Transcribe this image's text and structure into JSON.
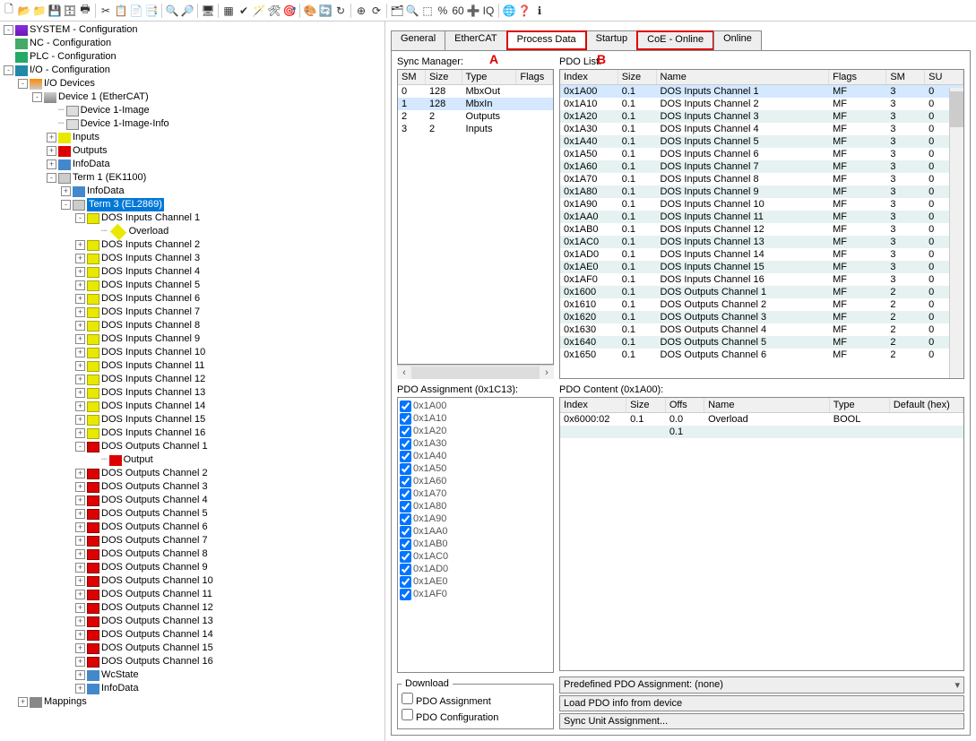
{
  "toolbar_icons": [
    "new-file",
    "open",
    "open-folder",
    "save",
    "save-all",
    "print",
    "|",
    "cut",
    "copy",
    "paste",
    "paste-sp",
    "|",
    "find",
    "find-next",
    "|",
    "device",
    "|",
    "box1",
    "check",
    "wizard",
    "wrench",
    "target",
    "|",
    "palette",
    "sync",
    "refresh",
    "|",
    "target2",
    "free-run",
    "|",
    "tree",
    "zoom",
    "net",
    "percent",
    "sixty",
    "plus",
    "iq",
    "|",
    "globe",
    "help",
    "about"
  ],
  "tree": [
    {
      "exp": "-",
      "ico": "i-sys",
      "label": "SYSTEM - Configuration"
    },
    {
      "exp": " ",
      "ico": "i-nc",
      "label": "NC - Configuration",
      "indent": 0
    },
    {
      "exp": " ",
      "ico": "i-plc",
      "label": "PLC - Configuration",
      "indent": 0
    },
    {
      "exp": "-",
      "ico": "i-io",
      "label": "I/O - Configuration",
      "indent": 0
    },
    {
      "exp": "-",
      "ico": "i-devs",
      "label": "I/O Devices",
      "indent": 1
    },
    {
      "exp": "-",
      "ico": "i-dev",
      "label": "Device 1 (EtherCAT)",
      "indent": 2
    },
    {
      "exp": " ",
      "ico": "i-img",
      "label": "Device 1-Image",
      "indent": 3,
      "dots": true
    },
    {
      "exp": " ",
      "ico": "i-img",
      "label": "Device 1-Image-Info",
      "indent": 3,
      "dots": true
    },
    {
      "exp": "+",
      "ico": "i-in",
      "label": "Inputs",
      "indent": 3
    },
    {
      "exp": "+",
      "ico": "i-out",
      "label": "Outputs",
      "indent": 3
    },
    {
      "exp": "+",
      "ico": "i-info",
      "label": "InfoData",
      "indent": 3
    },
    {
      "exp": "-",
      "ico": "i-term",
      "label": "Term 1 (EK1100)",
      "indent": 3
    },
    {
      "exp": "+",
      "ico": "i-info",
      "label": "InfoData",
      "indent": 4
    },
    {
      "exp": "-",
      "ico": "i-term",
      "label": "Term 3 (EL2869)",
      "indent": 4,
      "sel": true
    },
    {
      "exp": "-",
      "ico": "i-dosin",
      "label": "DOS Inputs Channel 1",
      "indent": 5
    },
    {
      "exp": " ",
      "ico": "i-ov",
      "label": "Overload",
      "indent": 6,
      "dots": true
    },
    {
      "exp": "+",
      "ico": "i-dosin",
      "label": "DOS Inputs Channel 2",
      "indent": 5
    },
    {
      "exp": "+",
      "ico": "i-dosin",
      "label": "DOS Inputs Channel 3",
      "indent": 5
    },
    {
      "exp": "+",
      "ico": "i-dosin",
      "label": "DOS Inputs Channel 4",
      "indent": 5
    },
    {
      "exp": "+",
      "ico": "i-dosin",
      "label": "DOS Inputs Channel 5",
      "indent": 5
    },
    {
      "exp": "+",
      "ico": "i-dosin",
      "label": "DOS Inputs Channel 6",
      "indent": 5
    },
    {
      "exp": "+",
      "ico": "i-dosin",
      "label": "DOS Inputs Channel 7",
      "indent": 5
    },
    {
      "exp": "+",
      "ico": "i-dosin",
      "label": "DOS Inputs Channel 8",
      "indent": 5
    },
    {
      "exp": "+",
      "ico": "i-dosin",
      "label": "DOS Inputs Channel 9",
      "indent": 5
    },
    {
      "exp": "+",
      "ico": "i-dosin",
      "label": "DOS Inputs Channel 10",
      "indent": 5
    },
    {
      "exp": "+",
      "ico": "i-dosin",
      "label": "DOS Inputs Channel 11",
      "indent": 5
    },
    {
      "exp": "+",
      "ico": "i-dosin",
      "label": "DOS Inputs Channel 12",
      "indent": 5
    },
    {
      "exp": "+",
      "ico": "i-dosin",
      "label": "DOS Inputs Channel 13",
      "indent": 5
    },
    {
      "exp": "+",
      "ico": "i-dosin",
      "label": "DOS Inputs Channel 14",
      "indent": 5
    },
    {
      "exp": "+",
      "ico": "i-dosin",
      "label": "DOS Inputs Channel 15",
      "indent": 5
    },
    {
      "exp": "+",
      "ico": "i-dosin",
      "label": "DOS Inputs Channel 16",
      "indent": 5
    },
    {
      "exp": "-",
      "ico": "i-dosout",
      "label": "DOS Outputs Channel 1",
      "indent": 5
    },
    {
      "exp": " ",
      "ico": "i-out",
      "label": "Output",
      "indent": 6,
      "dots": true
    },
    {
      "exp": "+",
      "ico": "i-dosout",
      "label": "DOS Outputs Channel 2",
      "indent": 5
    },
    {
      "exp": "+",
      "ico": "i-dosout",
      "label": "DOS Outputs Channel 3",
      "indent": 5
    },
    {
      "exp": "+",
      "ico": "i-dosout",
      "label": "DOS Outputs Channel 4",
      "indent": 5
    },
    {
      "exp": "+",
      "ico": "i-dosout",
      "label": "DOS Outputs Channel 5",
      "indent": 5
    },
    {
      "exp": "+",
      "ico": "i-dosout",
      "label": "DOS Outputs Channel 6",
      "indent": 5
    },
    {
      "exp": "+",
      "ico": "i-dosout",
      "label": "DOS Outputs Channel 7",
      "indent": 5
    },
    {
      "exp": "+",
      "ico": "i-dosout",
      "label": "DOS Outputs Channel 8",
      "indent": 5
    },
    {
      "exp": "+",
      "ico": "i-dosout",
      "label": "DOS Outputs Channel 9",
      "indent": 5
    },
    {
      "exp": "+",
      "ico": "i-dosout",
      "label": "DOS Outputs Channel 10",
      "indent": 5
    },
    {
      "exp": "+",
      "ico": "i-dosout",
      "label": "DOS Outputs Channel 11",
      "indent": 5
    },
    {
      "exp": "+",
      "ico": "i-dosout",
      "label": "DOS Outputs Channel 12",
      "indent": 5
    },
    {
      "exp": "+",
      "ico": "i-dosout",
      "label": "DOS Outputs Channel 13",
      "indent": 5
    },
    {
      "exp": "+",
      "ico": "i-dosout",
      "label": "DOS Outputs Channel 14",
      "indent": 5
    },
    {
      "exp": "+",
      "ico": "i-dosout",
      "label": "DOS Outputs Channel 15",
      "indent": 5
    },
    {
      "exp": "+",
      "ico": "i-dosout",
      "label": "DOS Outputs Channel 16",
      "indent": 5
    },
    {
      "exp": "+",
      "ico": "i-info",
      "label": "WcState",
      "indent": 5
    },
    {
      "exp": "+",
      "ico": "i-info",
      "label": "InfoData",
      "indent": 5
    },
    {
      "exp": "+",
      "ico": "i-map",
      "label": "Mappings",
      "indent": 1
    }
  ],
  "tabs": [
    "General",
    "EtherCAT",
    "Process Data",
    "Startup",
    "CoE - Online",
    "Online"
  ],
  "active_tab": 2,
  "hl_tabs": [
    2,
    4
  ],
  "annot_a": "A",
  "annot_b": "B",
  "sm": {
    "label": "Sync Manager:",
    "headers": [
      "SM",
      "Size",
      "Type",
      "Flags"
    ],
    "rows": [
      [
        "0",
        "128",
        "MbxOut",
        ""
      ],
      [
        "1",
        "128",
        "MbxIn",
        ""
      ],
      [
        "2",
        "2",
        "Outputs",
        ""
      ],
      [
        "3",
        "2",
        "Inputs",
        ""
      ]
    ],
    "sel": 1
  },
  "pdol": {
    "label": "PDO List:",
    "headers": [
      "Index",
      "Size",
      "Name",
      "Flags",
      "SM",
      "SU"
    ],
    "rows": [
      [
        "0x1A00",
        "0.1",
        "DOS Inputs Channel 1",
        "MF",
        "3",
        "0"
      ],
      [
        "0x1A10",
        "0.1",
        "DOS Inputs Channel 2",
        "MF",
        "3",
        "0"
      ],
      [
        "0x1A20",
        "0.1",
        "DOS Inputs Channel 3",
        "MF",
        "3",
        "0"
      ],
      [
        "0x1A30",
        "0.1",
        "DOS Inputs Channel 4",
        "MF",
        "3",
        "0"
      ],
      [
        "0x1A40",
        "0.1",
        "DOS Inputs Channel 5",
        "MF",
        "3",
        "0"
      ],
      [
        "0x1A50",
        "0.1",
        "DOS Inputs Channel 6",
        "MF",
        "3",
        "0"
      ],
      [
        "0x1A60",
        "0.1",
        "DOS Inputs Channel 7",
        "MF",
        "3",
        "0"
      ],
      [
        "0x1A70",
        "0.1",
        "DOS Inputs Channel 8",
        "MF",
        "3",
        "0"
      ],
      [
        "0x1A80",
        "0.1",
        "DOS Inputs Channel 9",
        "MF",
        "3",
        "0"
      ],
      [
        "0x1A90",
        "0.1",
        "DOS Inputs Channel 10",
        "MF",
        "3",
        "0"
      ],
      [
        "0x1AA0",
        "0.1",
        "DOS Inputs Channel 11",
        "MF",
        "3",
        "0"
      ],
      [
        "0x1AB0",
        "0.1",
        "DOS Inputs Channel 12",
        "MF",
        "3",
        "0"
      ],
      [
        "0x1AC0",
        "0.1",
        "DOS Inputs Channel 13",
        "MF",
        "3",
        "0"
      ],
      [
        "0x1AD0",
        "0.1",
        "DOS Inputs Channel 14",
        "MF",
        "3",
        "0"
      ],
      [
        "0x1AE0",
        "0.1",
        "DOS Inputs Channel 15",
        "MF",
        "3",
        "0"
      ],
      [
        "0x1AF0",
        "0.1",
        "DOS Inputs Channel 16",
        "MF",
        "3",
        "0"
      ],
      [
        "0x1600",
        "0.1",
        "DOS Outputs Channel 1",
        "MF",
        "2",
        "0"
      ],
      [
        "0x1610",
        "0.1",
        "DOS Outputs Channel 2",
        "MF",
        "2",
        "0"
      ],
      [
        "0x1620",
        "0.1",
        "DOS Outputs Channel 3",
        "MF",
        "2",
        "0"
      ],
      [
        "0x1630",
        "0.1",
        "DOS Outputs Channel 4",
        "MF",
        "2",
        "0"
      ],
      [
        "0x1640",
        "0.1",
        "DOS Outputs Channel 5",
        "MF",
        "2",
        "0"
      ],
      [
        "0x1650",
        "0.1",
        "DOS Outputs Channel 6",
        "MF",
        "2",
        "0"
      ]
    ],
    "sel": 0
  },
  "assign": {
    "label": "PDO Assignment (0x1C13):",
    "items": [
      "0x1A00",
      "0x1A10",
      "0x1A20",
      "0x1A30",
      "0x1A40",
      "0x1A50",
      "0x1A60",
      "0x1A70",
      "0x1A80",
      "0x1A90",
      "0x1AA0",
      "0x1AB0",
      "0x1AC0",
      "0x1AD0",
      "0x1AE0",
      "0x1AF0"
    ]
  },
  "content": {
    "label": "PDO Content (0x1A00):",
    "headers": [
      "Index",
      "Size",
      "Offs",
      "Name",
      "Type",
      "Default (hex)"
    ],
    "rows": [
      [
        "0x6000:02",
        "0.1",
        "0.0",
        "Overload",
        "BOOL",
        ""
      ],
      [
        "",
        "",
        "0.1",
        "",
        "",
        ""
      ]
    ]
  },
  "download": {
    "legend": "Download",
    "opts": [
      "PDO Assignment",
      "PDO Configuration"
    ]
  },
  "buttons": {
    "predef": "Predefined PDO Assignment: (none)",
    "load": "Load PDO info from device",
    "sync": "Sync Unit Assignment..."
  }
}
